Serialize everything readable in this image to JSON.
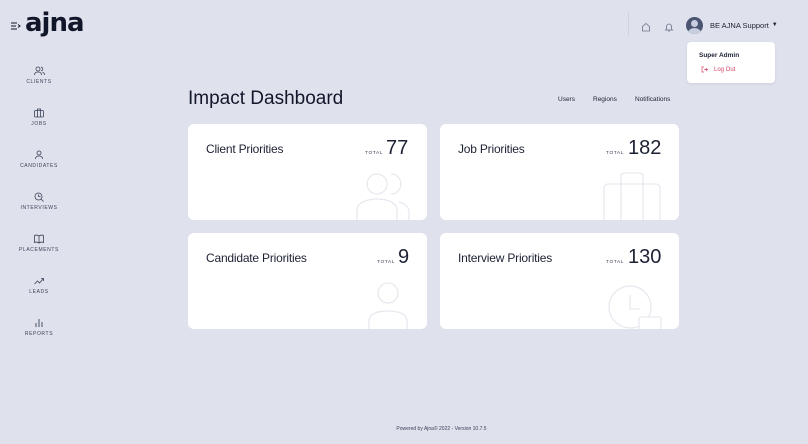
{
  "brand": {
    "logo_text": "ajna"
  },
  "header": {
    "user_name": "BE AJNA Support",
    "dropdown": {
      "role": "Super Admin",
      "logout_label": "Log Out"
    },
    "icons": [
      "home-icon",
      "bell-icon",
      "user-avatar"
    ]
  },
  "sidebar": {
    "items": [
      {
        "label": "CLIENTS",
        "icon": "users-icon"
      },
      {
        "label": "JOBS",
        "icon": "briefcase-icon"
      },
      {
        "label": "CANDIDATES",
        "icon": "user-icon"
      },
      {
        "label": "INTERVIEWS",
        "icon": "interview-icon"
      },
      {
        "label": "PLACEMENTS",
        "icon": "book-icon"
      },
      {
        "label": "LEADS",
        "icon": "trending-up-icon"
      },
      {
        "label": "REPORTS",
        "icon": "bar-chart-icon"
      }
    ]
  },
  "main": {
    "title": "Impact Dashboard",
    "links": [
      "Users",
      "Regions",
      "Notifications"
    ],
    "total_label": "TOTAL",
    "cards": [
      {
        "title": "Client Priorities",
        "count": "77"
      },
      {
        "title": "Job Priorities",
        "count": "182"
      },
      {
        "title": "Candidate Priorities",
        "count": "9"
      },
      {
        "title": "Interview Priorities",
        "count": "130"
      }
    ]
  },
  "footer": {
    "text": "Powered by Ajna© 2022 - Version 10.7.5"
  },
  "colors": {
    "background": "#dfe2ec",
    "card": "#ffffff",
    "logout": "#d64566",
    "text": "#1d2233"
  }
}
